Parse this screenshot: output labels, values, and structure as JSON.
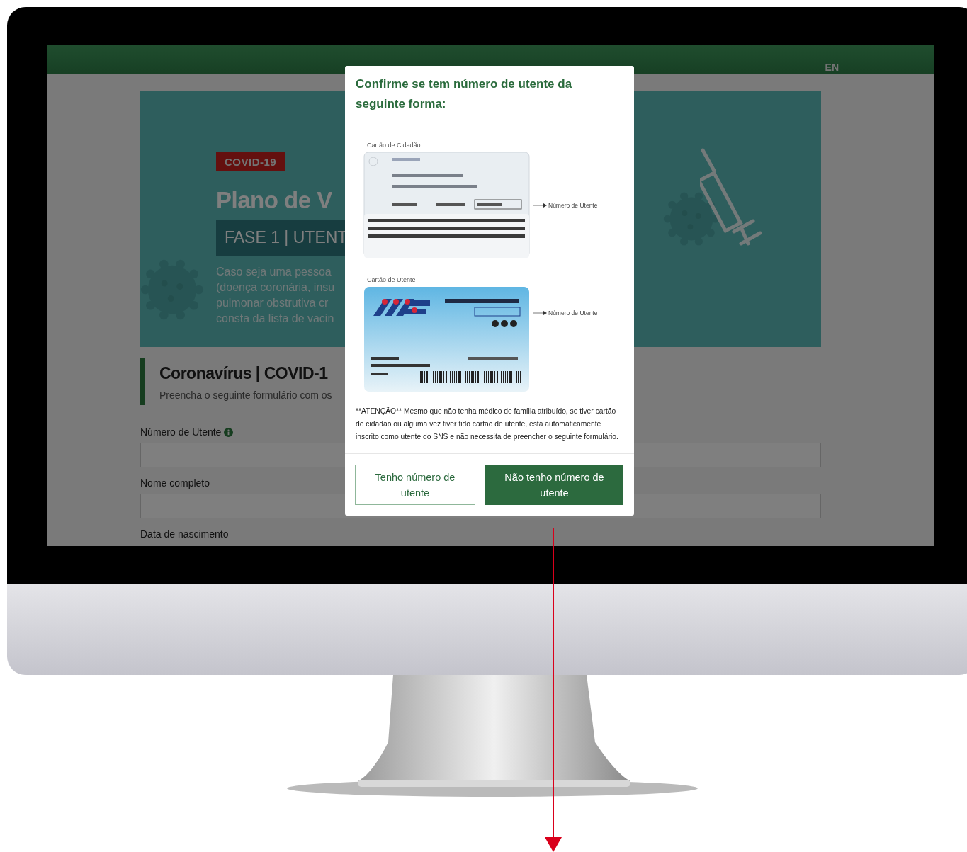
{
  "header": {
    "language": "EN"
  },
  "hero": {
    "badge": "COVID-19",
    "title": "Plano de V",
    "phase": "FASE 1 | UTENT",
    "lines": [
      "Caso seja uma pessoa",
      "(doença coronária, insu",
      "pulmonar obstrutiva cr",
      "consta da lista de vacin"
    ]
  },
  "form": {
    "title": "Coronavírus | COVID-1",
    "subtitle": "Preencha o seguinte formulário com os",
    "fields": [
      {
        "label": "Número de Utente",
        "info": true,
        "input": true
      },
      {
        "label": "Nome completo",
        "info": false,
        "input": true
      },
      {
        "label": "Data de nascimento",
        "info": false,
        "input": false
      }
    ]
  },
  "modal": {
    "title": "Confirme se tem número de utente da seguinte forma:",
    "cards": [
      {
        "kind": "citizen",
        "caption": "Cartão de Cidadão",
        "callout": "Número de Utente"
      },
      {
        "kind": "health",
        "caption": "Cartão de Utente",
        "callout": "Número de Utente"
      }
    ],
    "notice": "**ATENÇÃO** Mesmo que não tenha médico de família atribuído, se tiver cartão de cidadão ou alguma vez tiver tido cartão de utente, está automaticamente inscrito como utente do SNS e não necessita de preencher o seguinte formulário.",
    "buttons": [
      {
        "kind": "outline",
        "label": "Tenho número de utente"
      },
      {
        "kind": "primary",
        "label": "Não tenho número de utente"
      }
    ]
  }
}
